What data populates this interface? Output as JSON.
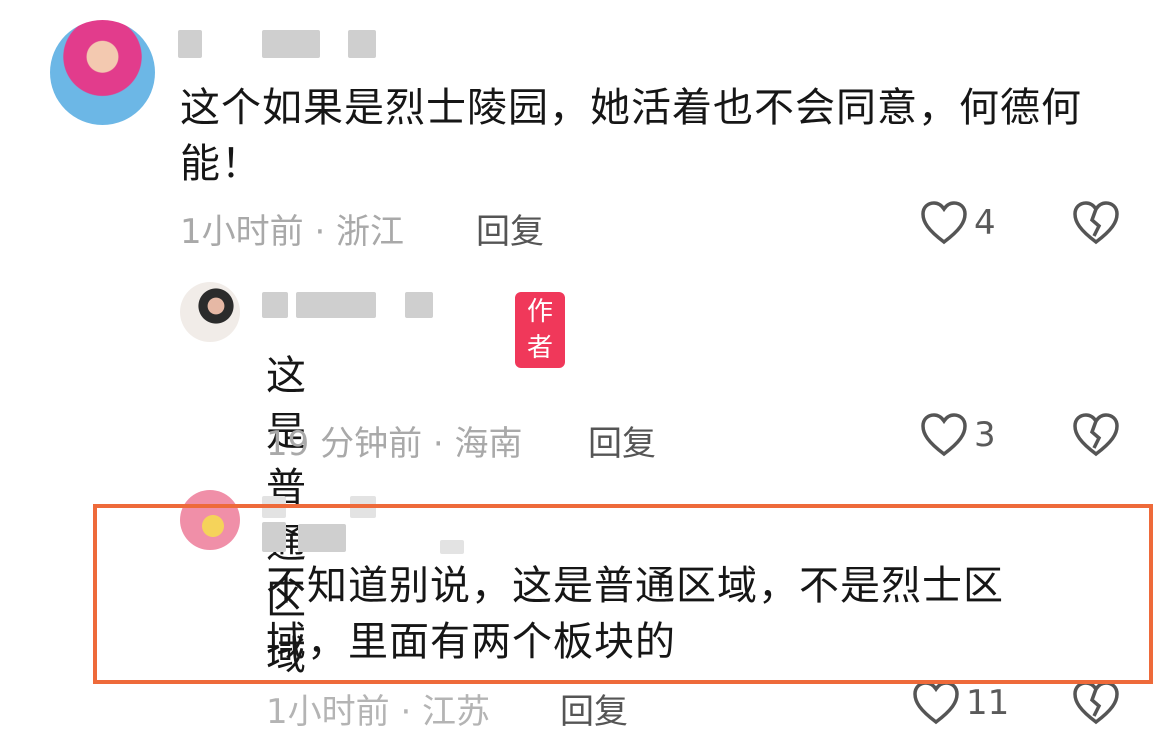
{
  "comments": [
    {
      "text": "这个如果是烈士陵园，她活着也不会同意，何德何能！",
      "meta": "1小时前 · 浙江",
      "reply_label": "回复",
      "likes": "4"
    },
    {
      "badge": "作者",
      "text": "这是普通区域",
      "meta": "19 分钟前 · 海南",
      "reply_label": "回复",
      "likes": "3"
    },
    {
      "text": "不知道别说，这是普通区域，不是烈士区域，里面有两个板块的",
      "meta": "1小时前 · 江苏",
      "reply_label": "回复",
      "likes": "11"
    }
  ],
  "colors": {
    "highlight_border": "#ee6a3a",
    "author_badge": "#f0385a",
    "meta_text": "#a9a9a9"
  },
  "icons": [
    "heart-outline-icon",
    "broken-heart-icon"
  ]
}
